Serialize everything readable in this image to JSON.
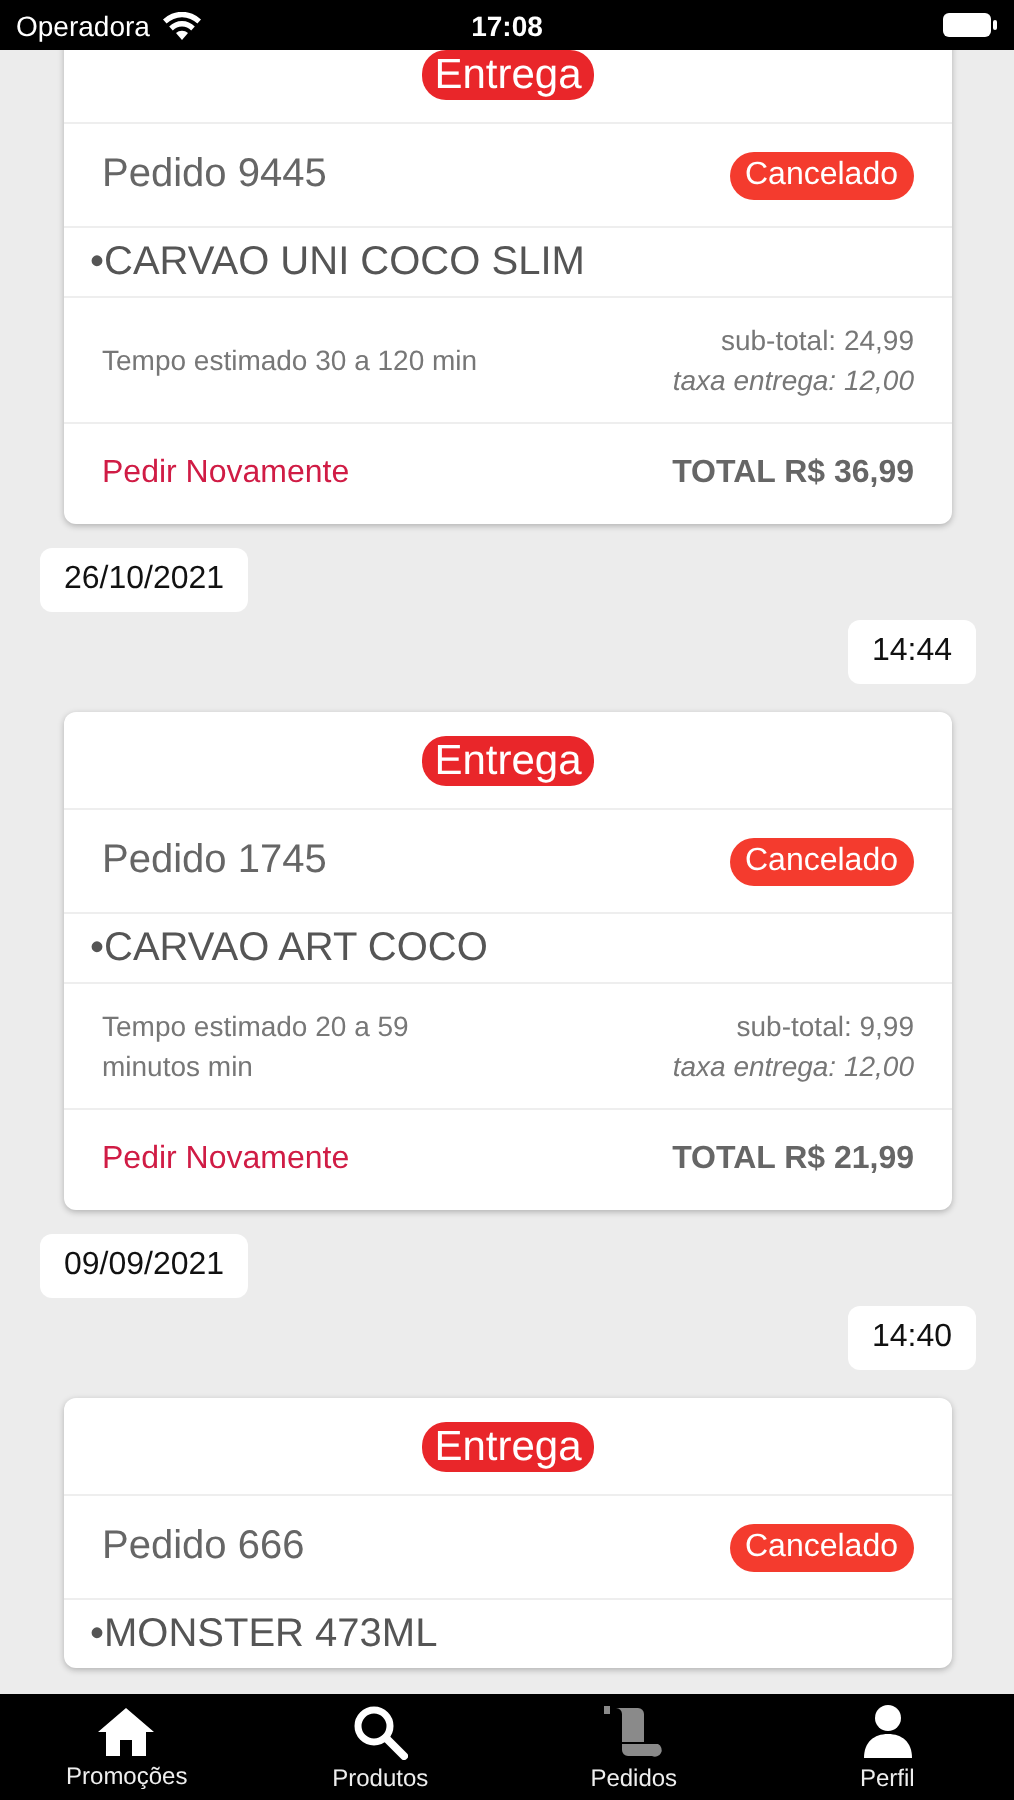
{
  "status_bar": {
    "carrier": "Operadora",
    "time": "17:08"
  },
  "orders": [
    {
      "delivery": "Entrega",
      "title": "Pedido 9445",
      "status": "Cancelado",
      "items": [
        "•CARVAO UNI COCO SLIM"
      ],
      "eta": "Tempo estimado 30 a 120 min",
      "subtotal": "sub-total: 24,99",
      "fee": "taxa entrega: 12,00",
      "action": "Pedir Novamente",
      "total": "TOTAL R$ 36,99"
    },
    {
      "date": "26/10/2021",
      "time": "14:44",
      "delivery": "Entrega",
      "title": "Pedido 1745",
      "status": "Cancelado",
      "items": [
        "•CARVAO ART COCO"
      ],
      "eta": "Tempo estimado 20 a 59 minutos min",
      "subtotal": "sub-total: 9,99",
      "fee": "taxa entrega: 12,00",
      "action": "Pedir Novamente",
      "total": "TOTAL R$ 21,99"
    },
    {
      "date": "09/09/2021",
      "time": "14:40",
      "delivery": "Entrega",
      "title": "Pedido 666",
      "status": "Cancelado",
      "items": [
        "•MONSTER 473ML"
      ]
    }
  ],
  "tabs": [
    {
      "kind": "home",
      "label": "Promoções",
      "selected": false
    },
    {
      "kind": "search",
      "label": "Produtos",
      "selected": false
    },
    {
      "kind": "scroll",
      "label": "Pedidos",
      "selected": true
    },
    {
      "kind": "person",
      "label": "Perfil",
      "selected": false
    }
  ]
}
